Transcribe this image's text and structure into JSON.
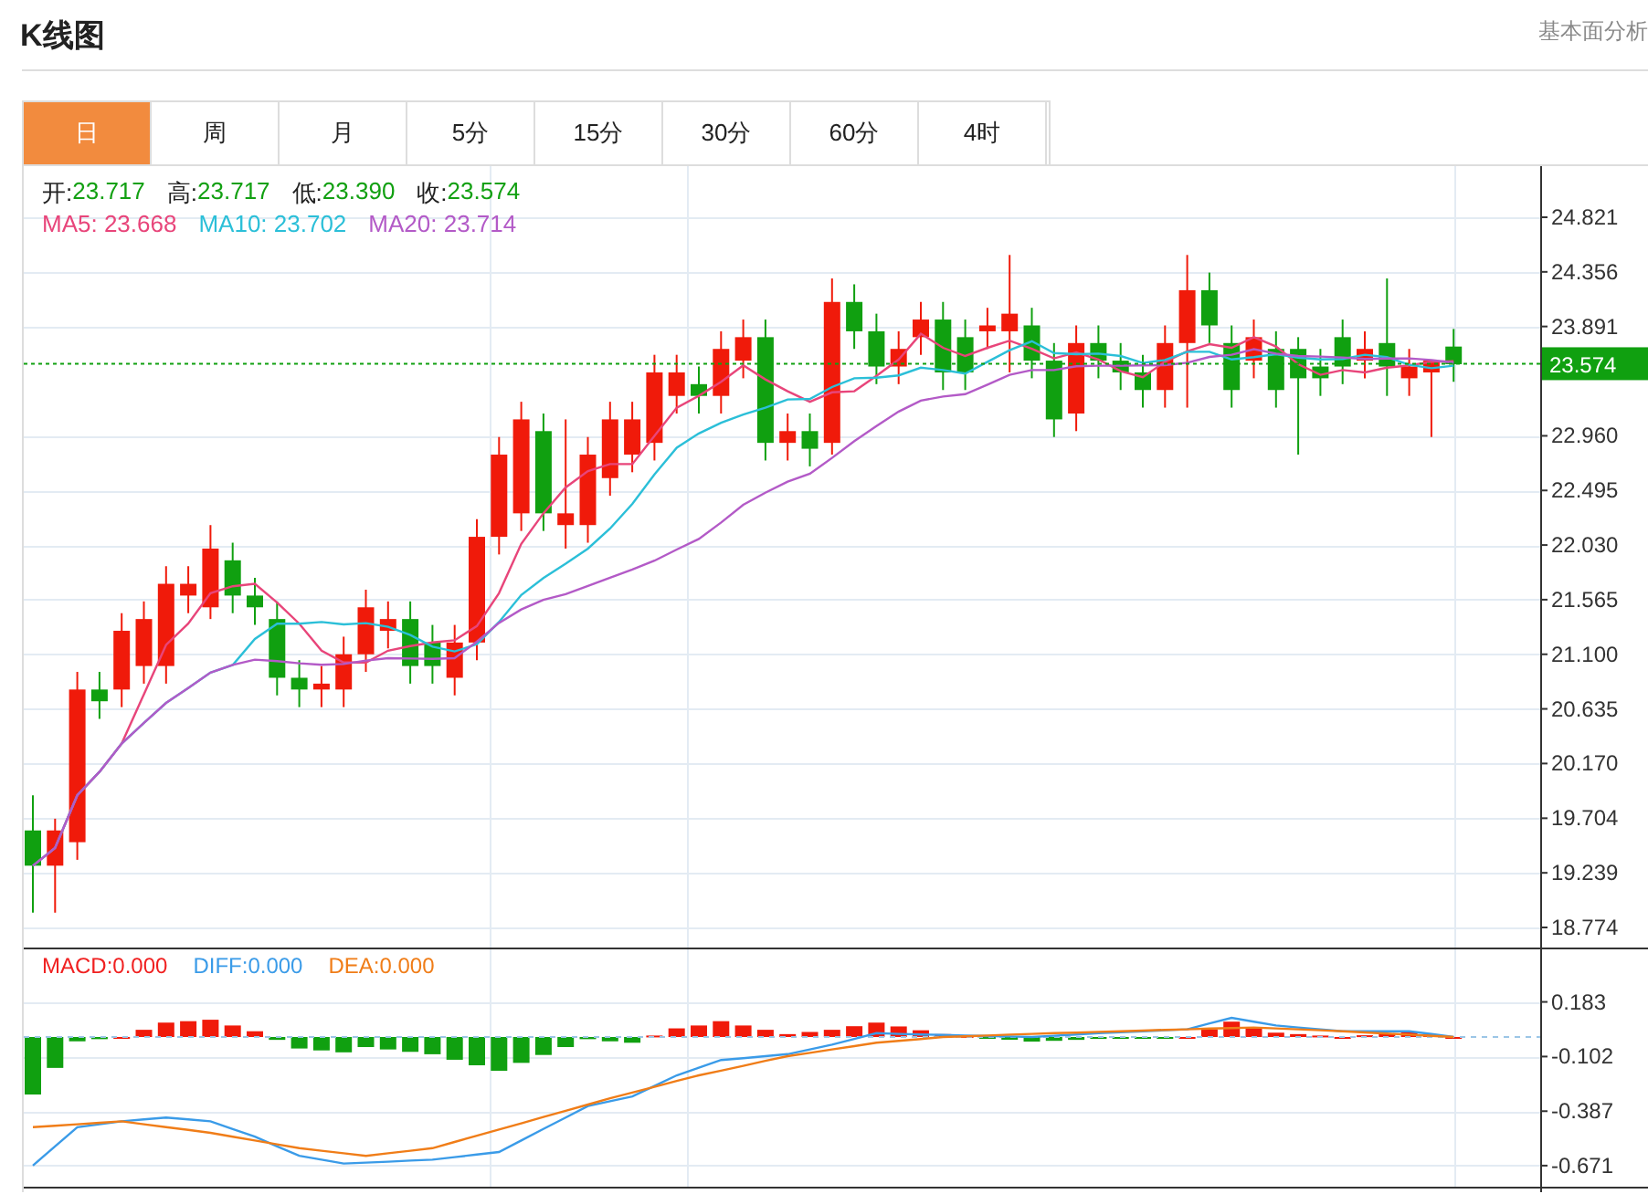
{
  "header": {
    "title": "K线图",
    "link": "基本面分析"
  },
  "tabs": [
    {
      "label": "日",
      "selected": true
    },
    {
      "label": "周",
      "selected": false
    },
    {
      "label": "月",
      "selected": false
    },
    {
      "label": "5分",
      "selected": false
    },
    {
      "label": "15分",
      "selected": false
    },
    {
      "label": "30分",
      "selected": false
    },
    {
      "label": "60分",
      "selected": false
    },
    {
      "label": "4时",
      "selected": false
    }
  ],
  "price_info": [
    {
      "label": "开:",
      "value": "23.717"
    },
    {
      "label": "高:",
      "value": "23.717"
    },
    {
      "label": "低:",
      "value": "23.390"
    },
    {
      "label": "收:",
      "value": "23.574"
    }
  ],
  "moving_averages": [
    {
      "label": "MA5: 23.668",
      "color": "#e8457a"
    },
    {
      "label": "MA10: 23.702",
      "color": "#2bbfd8"
    },
    {
      "label": "MA20: 23.714",
      "color": "#b35ac7"
    }
  ],
  "price_axis": {
    "ticks": [
      "24.821",
      "24.356",
      "23.891",
      "22.960",
      "22.495",
      "22.030",
      "21.565",
      "21.100",
      "20.635",
      "20.170",
      "19.704",
      "19.239",
      "18.774"
    ],
    "current_price": "23.574"
  },
  "macd_legend": [
    {
      "label": "MACD:0.000",
      "color": "#f02020"
    },
    {
      "label": "DIFF:0.000",
      "color": "#3a9be8"
    },
    {
      "label": "DEA:0.000",
      "color": "#f07d18"
    }
  ],
  "macd_axis": {
    "ticks": [
      "0.183",
      "-0.102",
      "-0.387",
      "-0.671"
    ]
  }
}
